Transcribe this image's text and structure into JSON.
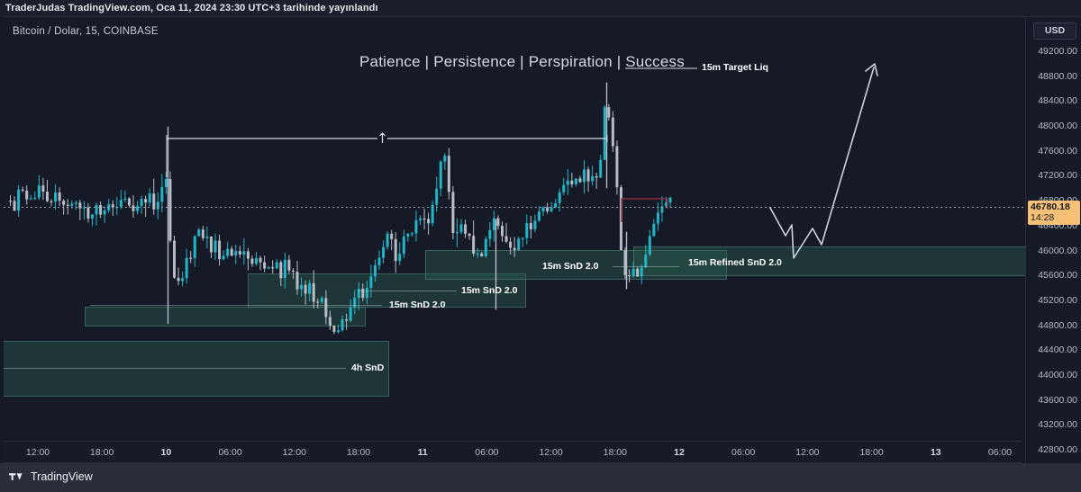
{
  "publication": {
    "text": "TraderJudas TradingView.com, Oca 11, 2024 23:30 UTC+3 tarihinde yayınlandı"
  },
  "legend": {
    "text": "Bitcoin / Dolar, 15, COINBASE"
  },
  "headline": {
    "text": "Patience | Persistence | Perspiration | Success"
  },
  "footer": {
    "brand": "TradingView"
  },
  "price_scale": {
    "currency": "USD",
    "current_price": "46780.18",
    "current_time": "14:28",
    "ticks": [
      "49200.00",
      "48800.00",
      "48400.00",
      "48000.00",
      "47600.00",
      "47200.00",
      "46800.00",
      "46400.00",
      "46000.00",
      "45600.00",
      "45200.00",
      "44800.00",
      "44400.00",
      "44000.00",
      "43600.00",
      "43200.00",
      "42800.00"
    ]
  },
  "time_scale": {
    "ticks": [
      {
        "label": "12:00",
        "bold": false
      },
      {
        "label": "18:00",
        "bold": false
      },
      {
        "label": "10",
        "bold": true
      },
      {
        "label": "06:00",
        "bold": false
      },
      {
        "label": "12:00",
        "bold": false
      },
      {
        "label": "18:00",
        "bold": false
      },
      {
        "label": "11",
        "bold": true
      },
      {
        "label": "06:00",
        "bold": false
      },
      {
        "label": "12:00",
        "bold": false
      },
      {
        "label": "18:00",
        "bold": false
      },
      {
        "label": "12",
        "bold": true
      },
      {
        "label": "06:00",
        "bold": false
      },
      {
        "label": "12:00",
        "bold": false
      },
      {
        "label": "18:00",
        "bold": false
      },
      {
        "label": "13",
        "bold": true
      },
      {
        "label": "06:00",
        "bold": false
      }
    ]
  },
  "annotations": {
    "target_liq": "15m Target Liq",
    "zones": [
      {
        "label": "4h SnD"
      },
      {
        "label": "15m SnD 2.0"
      },
      {
        "label": "15m SnD 2.0"
      },
      {
        "label": "15m SnD 2.0"
      },
      {
        "label": "15m Refined SnD 2.0"
      }
    ]
  },
  "markers": [
    {
      "name": "economic-event",
      "icon": "lightning-bolt-icon"
    },
    {
      "name": "us-economic-event",
      "icon": "us-flag-icon"
    }
  ],
  "colors": {
    "background": "#151a26",
    "up_candle": "#22b5c8",
    "down_candle": "#b8bcc6",
    "zone_fill": "#2a5c52",
    "price_badge": "#f6c177",
    "resistance_line": "#8e2b3c",
    "projection": "#cfd3dd"
  },
  "chart_data": {
    "type": "candlestick",
    "title": "Bitcoin / Dolar, 15, COINBASE",
    "symbol": "BTCUSD",
    "interval": "15",
    "exchange": "COINBASE",
    "ylabel": "USD",
    "ylim": [
      42800,
      49200
    ],
    "ytick_step": 400,
    "xlabel": "",
    "last_price": 46780.18,
    "grid": false,
    "legend_position": "top-left"
  }
}
